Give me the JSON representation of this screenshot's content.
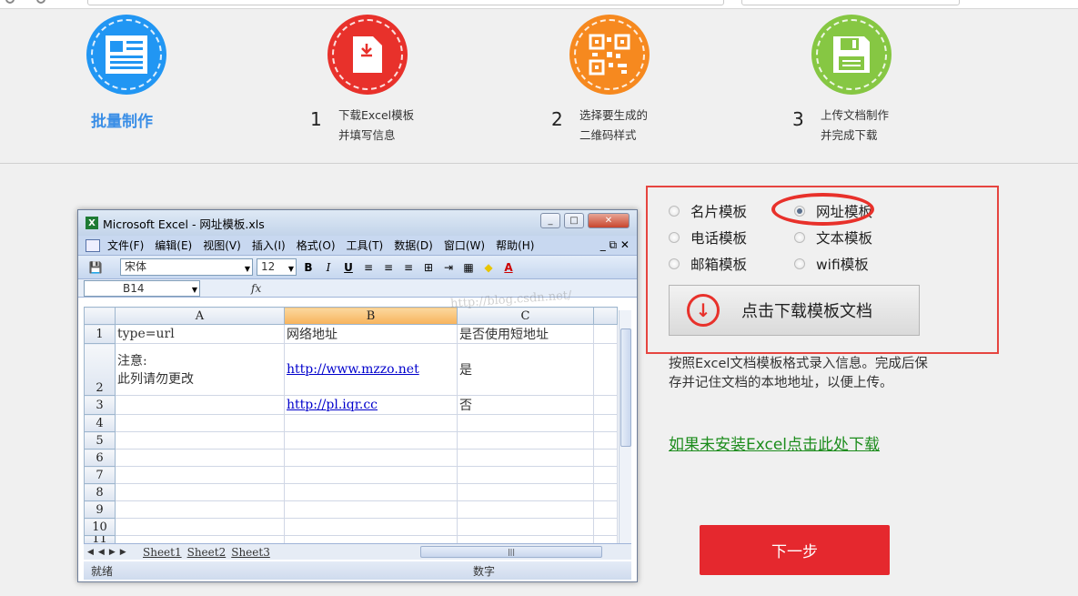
{
  "steps": {
    "title": "批量制作",
    "items": [
      {
        "num": "1",
        "line1": "下载Excel模板",
        "line2": "并填写信息"
      },
      {
        "num": "2",
        "line1": "选择要生成的",
        "line2": "二维码样式"
      },
      {
        "num": "3",
        "line1": "上传文档制作",
        "line2": "并完成下载"
      }
    ]
  },
  "excel": {
    "window_title": "Microsoft Excel - 网址模板.xls",
    "menu": [
      "文件(F)",
      "编辑(E)",
      "视图(V)",
      "插入(I)",
      "格式(O)",
      "工具(T)",
      "数据(D)",
      "窗口(W)",
      "帮助(H)"
    ],
    "font": "宋体",
    "font_size": "12",
    "name_box": "B14",
    "fx": "fx",
    "columns": [
      "A",
      "B",
      "C"
    ],
    "rows": [
      {
        "n": "1",
        "a": "type=url",
        "b": "网络地址",
        "c": "是否使用短地址"
      },
      {
        "n": "2",
        "a1": "注意:",
        "a2": "此列请勿更改",
        "b": "http://www.mzzo.net",
        "c": "是"
      },
      {
        "n": "3",
        "a": "",
        "b": "http://pl.iqr.cc",
        "c": "否"
      },
      {
        "n": "4"
      },
      {
        "n": "5"
      },
      {
        "n": "6"
      },
      {
        "n": "7"
      },
      {
        "n": "8"
      },
      {
        "n": "9"
      },
      {
        "n": "10"
      },
      {
        "n": "11"
      }
    ],
    "sheets": [
      "Sheet1",
      "Sheet2",
      "Sheet3"
    ],
    "status_ready": "就绪",
    "status_num": "数字"
  },
  "watermark": "http://blog.csdn.net/",
  "templates": {
    "options": [
      {
        "label": "名片模板",
        "selected": false
      },
      {
        "label": "网址模板",
        "selected": true
      },
      {
        "label": "电话模板",
        "selected": false
      },
      {
        "label": "文本模板",
        "selected": false
      },
      {
        "label": "邮箱模板",
        "selected": false
      },
      {
        "label": "wifi模板",
        "selected": false
      }
    ],
    "download_label": "点击下载模板文档"
  },
  "description": "按照Excel文档模板格式录入信息。完成后保存并记住文档的本地地址，以便上传。",
  "install_link": "如果未安装Excel点击此处下载",
  "next_label": "下一步",
  "colors": {
    "blue": "#2196f3",
    "red": "#e8312b",
    "orange": "#f6891f",
    "green": "#86c743",
    "link_green": "#1c8c1c"
  }
}
